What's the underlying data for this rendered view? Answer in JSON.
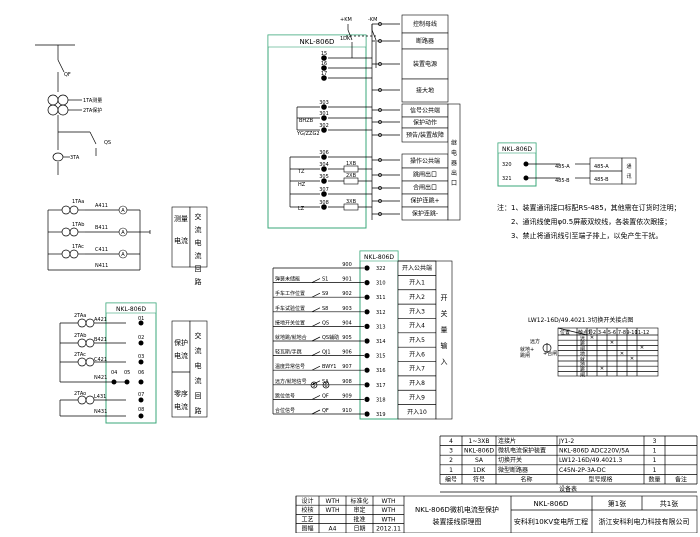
{
  "top_box": {
    "title": "NKL-806D",
    "terminals": [
      "15",
      "16",
      "17",
      "303",
      "301",
      "302",
      "306",
      "304",
      "305",
      "307",
      "308"
    ],
    "relays": [
      "BHZB",
      "YG/ZZG2",
      "TZ",
      "HZ",
      "LZ"
    ],
    "dc_labels": [
      "+KM",
      "-KM"
    ],
    "dk_label": "1DK",
    "links": [
      "1XB",
      "2XB",
      "3XB"
    ]
  },
  "top_right_table": [
    "控制母线",
    "断路器",
    "装置电源",
    "接大地",
    "信号公共端",
    "保护动作",
    "预告/装置故障",
    "操作公共端",
    "跳闸出口",
    "合闸出口",
    "保护连跳+",
    "保护连跳-"
  ],
  "relay_output_label": "继电器出口",
  "left_single_line": [
    "QF",
    "1TA测量",
    "2TA保护",
    "QS",
    "3TA"
  ],
  "measure_ct": {
    "ct_names": [
      "1TAa",
      "1TAb",
      "1TAc"
    ],
    "wires": [
      "A411",
      "B411",
      "C411",
      "N411"
    ],
    "meters": [
      "A",
      "A",
      "A"
    ],
    "label": "测量电流",
    "label_v": "交流电流回路"
  },
  "protect_box": {
    "title": "NKL-806D",
    "ct_names": [
      "2TAa",
      "2TAb",
      "2TAc",
      "2TAo"
    ],
    "wires": [
      "A421",
      "B421",
      "C421",
      "N421",
      "L431",
      "N431"
    ],
    "terminals": [
      "01",
      "02",
      "03",
      "04",
      "05",
      "06",
      "07",
      "08"
    ],
    "label_protect": "保护电流",
    "label_zero": "零序电流",
    "label_v": "交流电流回路"
  },
  "di_box": {
    "title": "NKL-806D",
    "switch_labels": [
      "弹簧未储能",
      "手车工作位置",
      "手车试验位置",
      "接地开关位置",
      "就地跳/就地合",
      "轻瓦斯/手跳",
      "温度异常信号",
      "远方/就地信号",
      "跳位信号",
      "合位信号"
    ],
    "device_labels": [
      "S1",
      "S9",
      "S8",
      "QS",
      "QS辅助",
      "QJ1",
      "BWY1",
      "SA",
      "QF",
      "QF"
    ],
    "left_terminals": [
      "900",
      "901",
      "902",
      "903",
      "904",
      "905",
      "906",
      "907",
      "908",
      "909",
      "910"
    ],
    "right_terminals": [
      "322",
      "310",
      "311",
      "312",
      "313",
      "314",
      "315",
      "316",
      "317",
      "318",
      "319"
    ],
    "inputs": [
      "开入公共端",
      "开入1",
      "开入2",
      "开入3",
      "开入4",
      "开入5",
      "开入6",
      "开入7",
      "开入8",
      "开入9",
      "开入10"
    ],
    "label_v": "开关量输入"
  },
  "comm_box": {
    "title": "NKL-806D",
    "terminals": [
      "320",
      "321"
    ],
    "lines": [
      "485-A",
      "485-B"
    ],
    "label_v": "通讯"
  },
  "notes": [
    "注：1、装置通讯接口标配RS-485，其他需在订货时注明；",
    "2、通讯线使用φ0.5屏蔽双绞线，各装置依次跟接；",
    "3、禁止将通讯线引至端子排上，以免产生干扰。"
  ],
  "switch_diagram": {
    "title": "LW12-16D/49.4021.3切换开关接点图",
    "header": [
      "位置",
      "触点号",
      "1-2",
      "3-4",
      "5-6",
      "7-8",
      "9-10",
      "11-12"
    ],
    "rows": [
      "远",
      "跳",
      "闸",
      "地",
      "就",
      "地",
      "跳",
      "闸"
    ],
    "label_left": "远方",
    "label_trip": "就地+跳闸",
    "label_close": "就地+合闸",
    "label_right": "跳闸"
  },
  "bom": {
    "rows": [
      [
        "4",
        "1~3XB",
        "连接片",
        "JY1-2",
        "3",
        ""
      ],
      [
        "3",
        "NKL-806D",
        "微机电流保护装置",
        "NKL-806D  ADC220V/5A",
        "1",
        ""
      ],
      [
        "2",
        "SA",
        "切换开关",
        "LW12-16D/49.4021.3",
        "1",
        ""
      ],
      [
        "1",
        "1DK",
        "微型断路器",
        "C45N-2P-3A-DC",
        "1",
        ""
      ]
    ],
    "header": [
      "编号",
      "符号",
      "名称",
      "型号规格",
      "数量",
      "备注"
    ],
    "footer": "设备表"
  },
  "title_block": {
    "sign_rows": [
      [
        "设计",
        "WTH",
        "标准化",
        "WTH"
      ],
      [
        "校核",
        "WTH",
        "审定",
        "WTH"
      ],
      [
        "工艺",
        "",
        "批准",
        "WTH"
      ],
      [
        "图幅",
        "A4",
        "日期",
        "2012.11"
      ]
    ],
    "drawing_name": "NKL-806D微机电流型保护装置接线原理图",
    "device": "NKL-806D",
    "sheet": "第1张",
    "total": "共1张",
    "project": "安科利10KV变电所工程",
    "company": "浙江安科利电力科技有限公司"
  }
}
